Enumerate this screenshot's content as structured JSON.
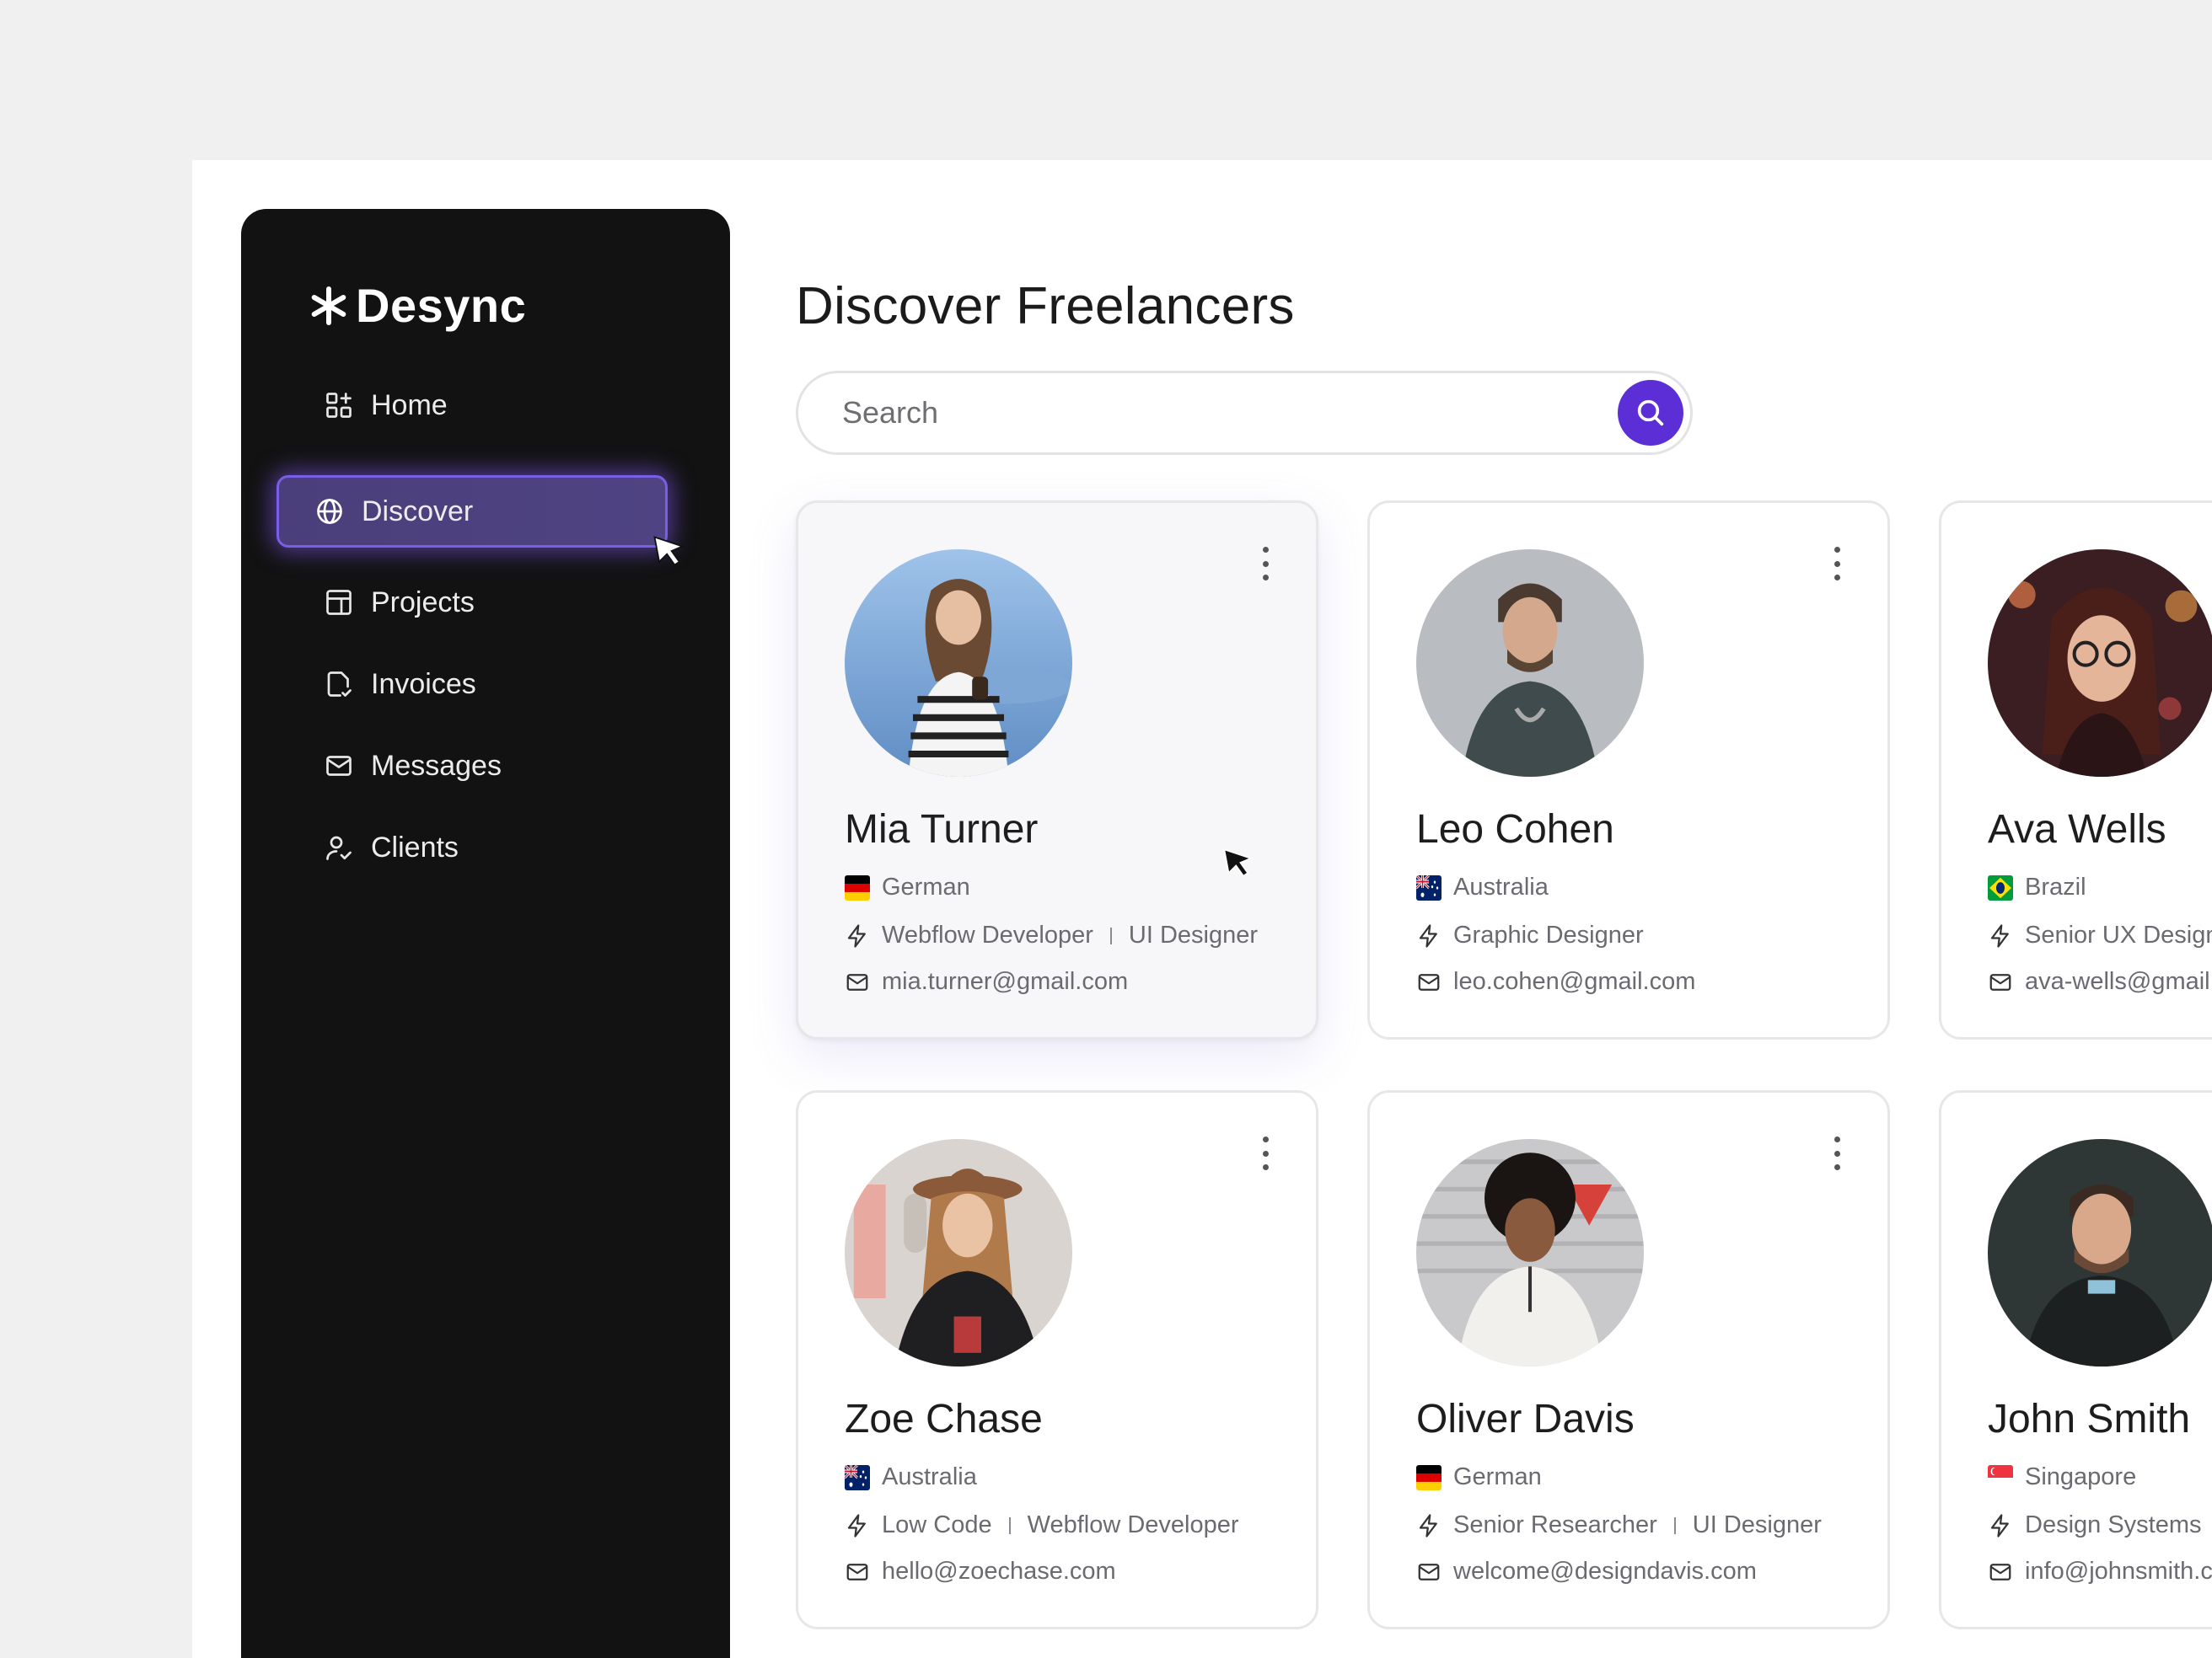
{
  "brand": {
    "name": "Desync"
  },
  "sidebar": {
    "items": [
      {
        "label": "Home",
        "icon": "grid-icon"
      },
      {
        "label": "Discover",
        "icon": "globe-icon",
        "active": true
      },
      {
        "label": "Projects",
        "icon": "layout-icon"
      },
      {
        "label": "Invoices",
        "icon": "document-check-icon"
      },
      {
        "label": "Messages",
        "icon": "mail-icon"
      },
      {
        "label": "Clients",
        "icon": "user-check-icon"
      }
    ]
  },
  "main": {
    "title": "Discover Freelancers",
    "search": {
      "placeholder": "Search",
      "value": ""
    },
    "freelancers": [
      {
        "name": "Mia Turner",
        "country": "German",
        "flag": "germany",
        "roles": [
          "Webflow Developer",
          "UI Designer"
        ],
        "email": "mia.turner@gmail.com"
      },
      {
        "name": "Leo Cohen",
        "country": "Australia",
        "flag": "australia",
        "roles": [
          "Graphic Designer"
        ],
        "email": "leo.cohen@gmail.com"
      },
      {
        "name": "Ava Wells",
        "country": "Brazil",
        "flag": "brazil",
        "roles": [
          "Senior UX Designe"
        ],
        "email": "ava-wells@gmail.c"
      },
      {
        "name": "Zoe Chase",
        "country": "Australia",
        "flag": "australia",
        "roles": [
          "Low Code",
          "Webflow Developer"
        ],
        "email": "hello@zoechase.com"
      },
      {
        "name": "Oliver Davis",
        "country": "German",
        "flag": "germany",
        "roles": [
          "Senior Researcher",
          "UI Designer"
        ],
        "email": "welcome@designdavis.com"
      },
      {
        "name": "John Smith",
        "country": "Singapore",
        "flag": "singapore",
        "roles": [
          "Design Systems",
          ""
        ],
        "email": "info@johnsmith.c"
      }
    ]
  },
  "colors": {
    "accent": "#5b2ed6",
    "sidebar_bg": "#121212",
    "active_border": "#7a5ee6",
    "page_bg": "#f0f0f1"
  }
}
